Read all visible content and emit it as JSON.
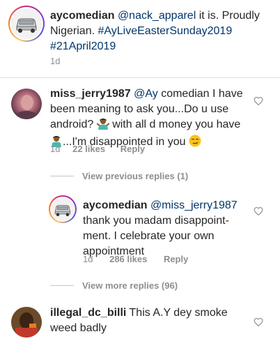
{
  "caption": {
    "username": "aycomedian",
    "mention": "@nack_apparel",
    "text": "it is. Proudly Nigerian.",
    "hashtag1": "#AyLiveEasterSunday2019",
    "hashtag2": "#21April2019",
    "time": "1d"
  },
  "comment1": {
    "username": "miss_jerry1987",
    "mention": "@Ay",
    "line1_rest": "comedian I have",
    "line2": "been meaning to ask you...Do u use",
    "line3a": "android?",
    "line3b": "with all d money you have",
    "line4": "...I'm disappointed in you",
    "time": "1d",
    "likes": "22 likes",
    "reply_label": "Reply"
  },
  "view_previous": "View previous replies (1)",
  "reply1": {
    "username": "aycomedian",
    "mention": "@miss_jerry1987",
    "line2": "thank you madam disappoint-",
    "line3": "ment. I celebrate your own",
    "line4": "appointment",
    "time": "1d",
    "likes": "286 likes",
    "reply_label": "Reply"
  },
  "view_more": "View more replies (96)",
  "comment2": {
    "username": "illegal_dc_billi",
    "line1_rest": "This A.Y dey smoke",
    "line2": "weed badly"
  },
  "icons": {
    "heart": "heart-outline-icon",
    "shrug": "person-shrugging-emoji",
    "smirk": "smirking-face-emoji"
  },
  "colors": {
    "link": "#003569",
    "muted": "#8e8e8e"
  }
}
